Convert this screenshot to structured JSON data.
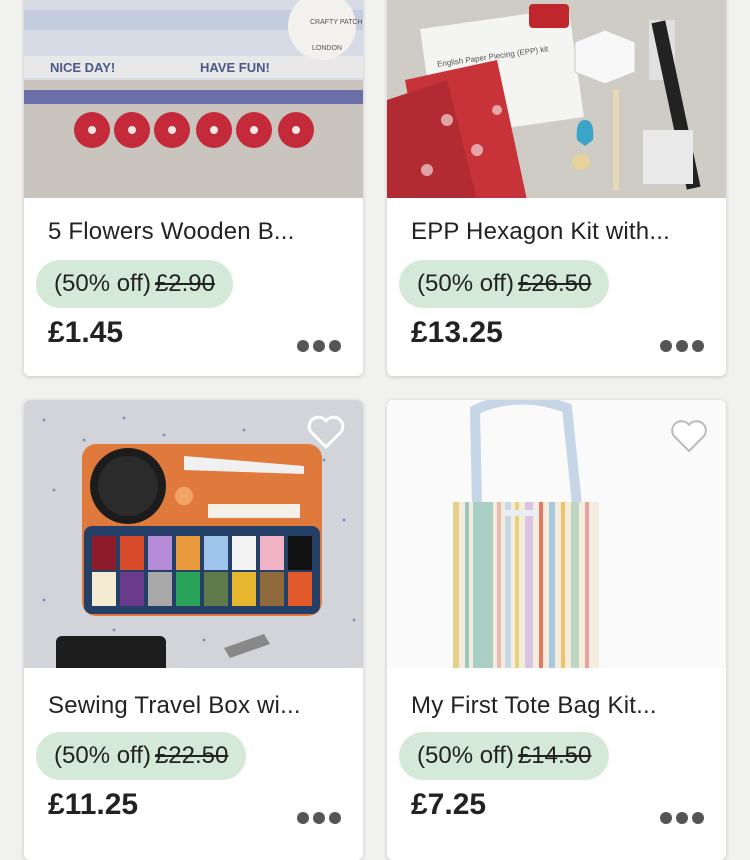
{
  "products": [
    {
      "title": "5 Flowers  Wooden B...",
      "discount": "(50% off)",
      "original_price": "£2.90",
      "price": "£1.45",
      "image_text": [
        "NICE DAY!",
        "HAVE FUN!",
        "CRAFTY PATCH",
        "LONDON"
      ]
    },
    {
      "title": "EPP Hexagon Kit with...",
      "discount": "(50% off)",
      "original_price": "£26.50",
      "price": "£13.25",
      "image_text": [
        "English Paper Piecing (EPP) kit"
      ]
    },
    {
      "title": "Sewing Travel Box wi...",
      "discount": "(50% off)",
      "original_price": "£22.50",
      "price": "£11.25",
      "image_text": []
    },
    {
      "title": "My First Tote Bag Kit...",
      "discount": "(50% off)",
      "original_price": "£14.50",
      "price": "£7.25",
      "image_text": []
    }
  ],
  "colors": {
    "discount_bg": "#d4e9d7",
    "background": "#f1f1ef",
    "text": "#222222"
  },
  "icons": {
    "favorite": "heart-outline-icon",
    "more": "more-options-icon"
  }
}
